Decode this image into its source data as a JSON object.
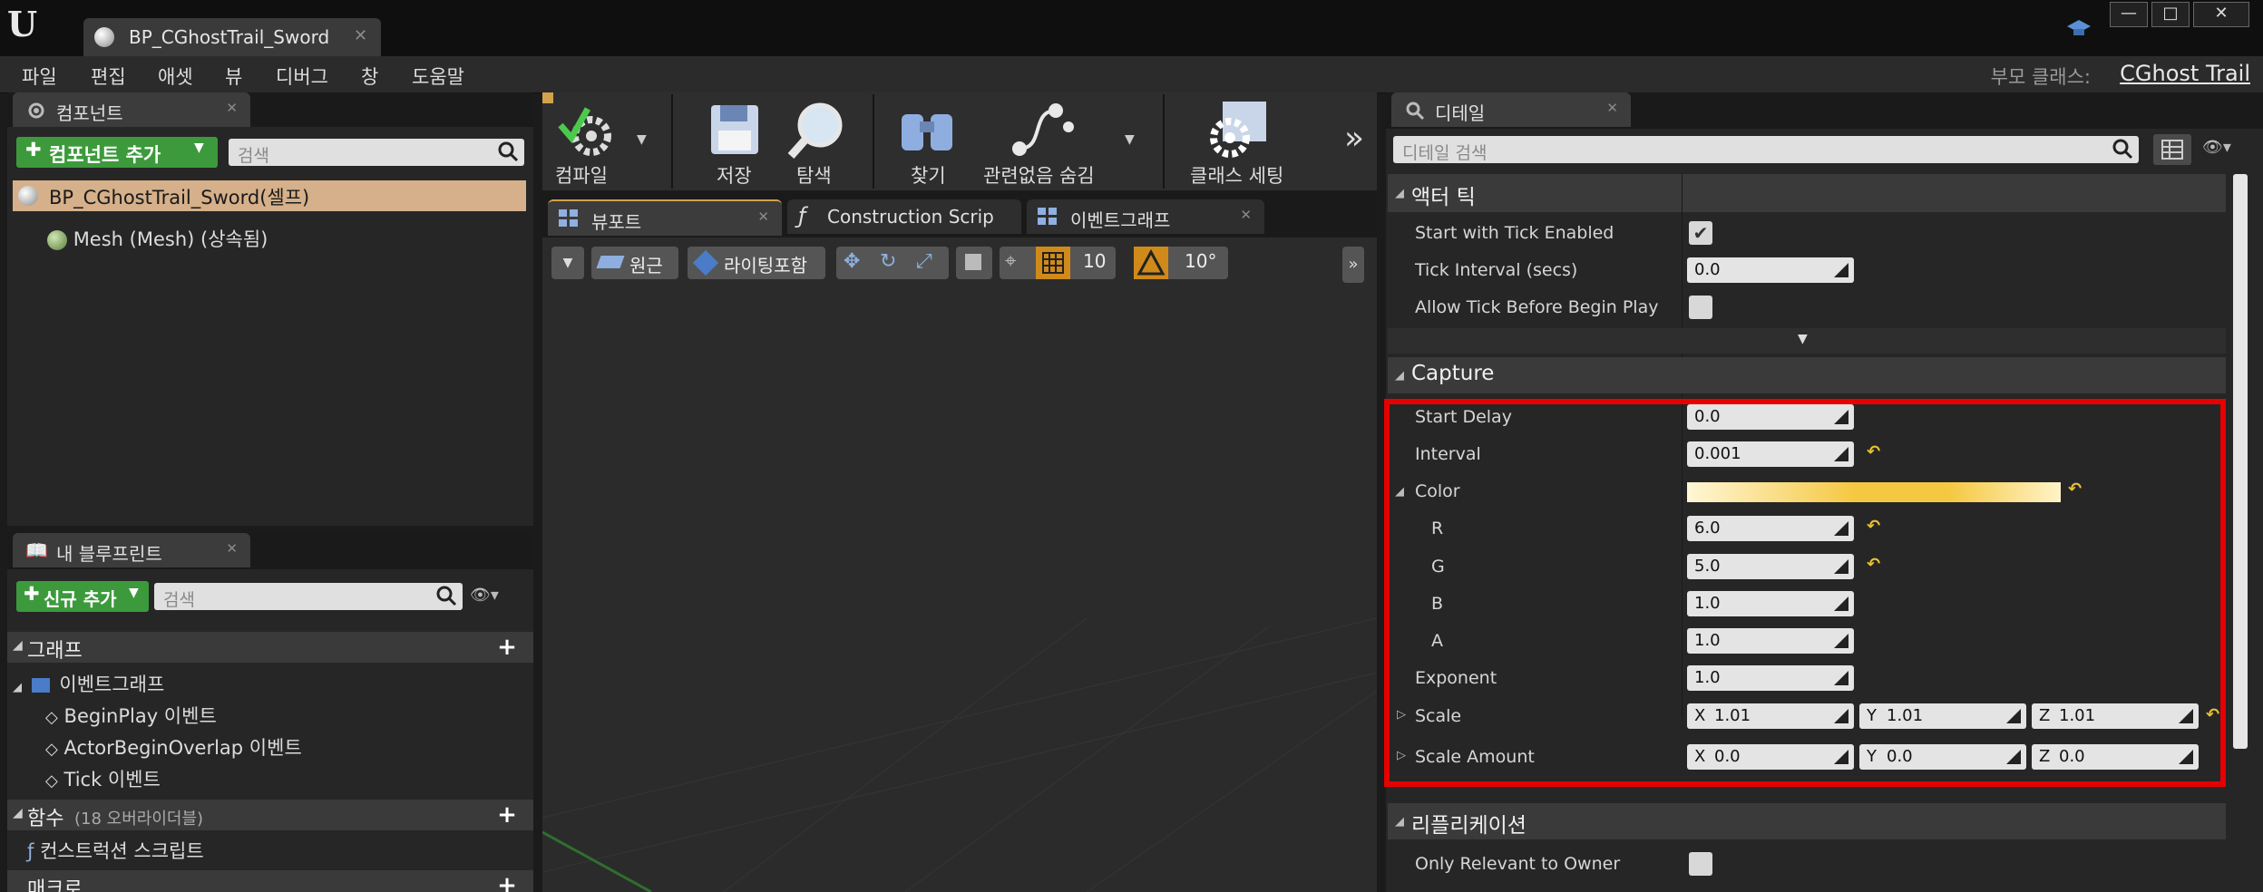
{
  "app": {
    "logo_glyph": "U",
    "document_tab": "BP_CGhostTrail_Sword"
  },
  "window_buttons": [
    "—",
    "□",
    "✕"
  ],
  "menu": {
    "items": [
      "파일",
      "편집",
      "애셋",
      "뷰",
      "디버그",
      "창",
      "도움말"
    ],
    "parent_class_label": "부모 클래스:",
    "parent_class_value": "CGhost Trail"
  },
  "components": {
    "tab": "컴포넌트",
    "add_button": "컴포넌트 추가",
    "search_placeholder": "검색",
    "items": [
      "BP_CGhostTrail_Sword(셀프)",
      "Mesh (Mesh) (상속됨)"
    ]
  },
  "my_blueprint": {
    "tab": "내 블루프린트",
    "add_button": "신규 추가",
    "search_placeholder": "검색",
    "graphs_header": "그래프",
    "event_graph": "이벤트그래프",
    "events": [
      "BeginPlay 이벤트",
      "ActorBeginOverlap 이벤트",
      "Tick 이벤트"
    ],
    "functions_header": "함수",
    "functions_count": "(18 오버라이더블)",
    "construction_script": "컨스트럭션 스크립트",
    "macros_header": "매크로"
  },
  "toolbar": {
    "compile": "컴파일",
    "save": "저장",
    "browse": "탐색",
    "find": "찾기",
    "hide_unrelated": "관련없음 숨김",
    "class_settings": "클래스 세팅",
    "more": "»"
  },
  "editor_tabs": [
    "뷰포트",
    "Construction Scrip",
    "이벤트그래프"
  ],
  "viewport_toolbar": {
    "perspective": "원근",
    "lit": "라이팅포함",
    "grid_snap": "10",
    "rotation_snap": "10°"
  },
  "details": {
    "tab": "디테일",
    "search_placeholder": "디테일 검색",
    "actor_tick": {
      "header": "액터 틱",
      "start_with_tick_enabled": "Start with Tick Enabled",
      "start_with_tick_enabled_value": true,
      "tick_interval": "Tick Interval (secs)",
      "tick_interval_value": "0.0",
      "allow_tick": "Allow Tick Before Begin Play",
      "allow_tick_value": false
    },
    "capture": {
      "header": "Capture",
      "start_delay": "Start Delay",
      "start_delay_value": "0.0",
      "interval": "Interval",
      "interval_value": "0.001",
      "color": "Color",
      "r": "R",
      "r_value": "6.0",
      "g": "G",
      "g_value": "5.0",
      "b": "B",
      "b_value": "1.0",
      "a": "A",
      "a_value": "1.0",
      "exponent": "Exponent",
      "exponent_value": "1.0",
      "scale": "Scale",
      "scale_x": "1.01",
      "scale_y": "1.01",
      "scale_z": "1.01",
      "scale_amount": "Scale Amount",
      "scale_amount_x": "0.0",
      "scale_amount_y": "0.0",
      "scale_amount_z": "0.0",
      "axis_x": "X",
      "axis_y": "Y",
      "axis_z": "Z"
    },
    "replication": {
      "header": "리플리케이션",
      "only_relevant": "Only Relevant to Owner",
      "only_relevant_value": false
    }
  },
  "colors": {
    "highlight": "#e60000",
    "color_swatch": "#f5c842",
    "add_green": "#3c9a3c"
  }
}
